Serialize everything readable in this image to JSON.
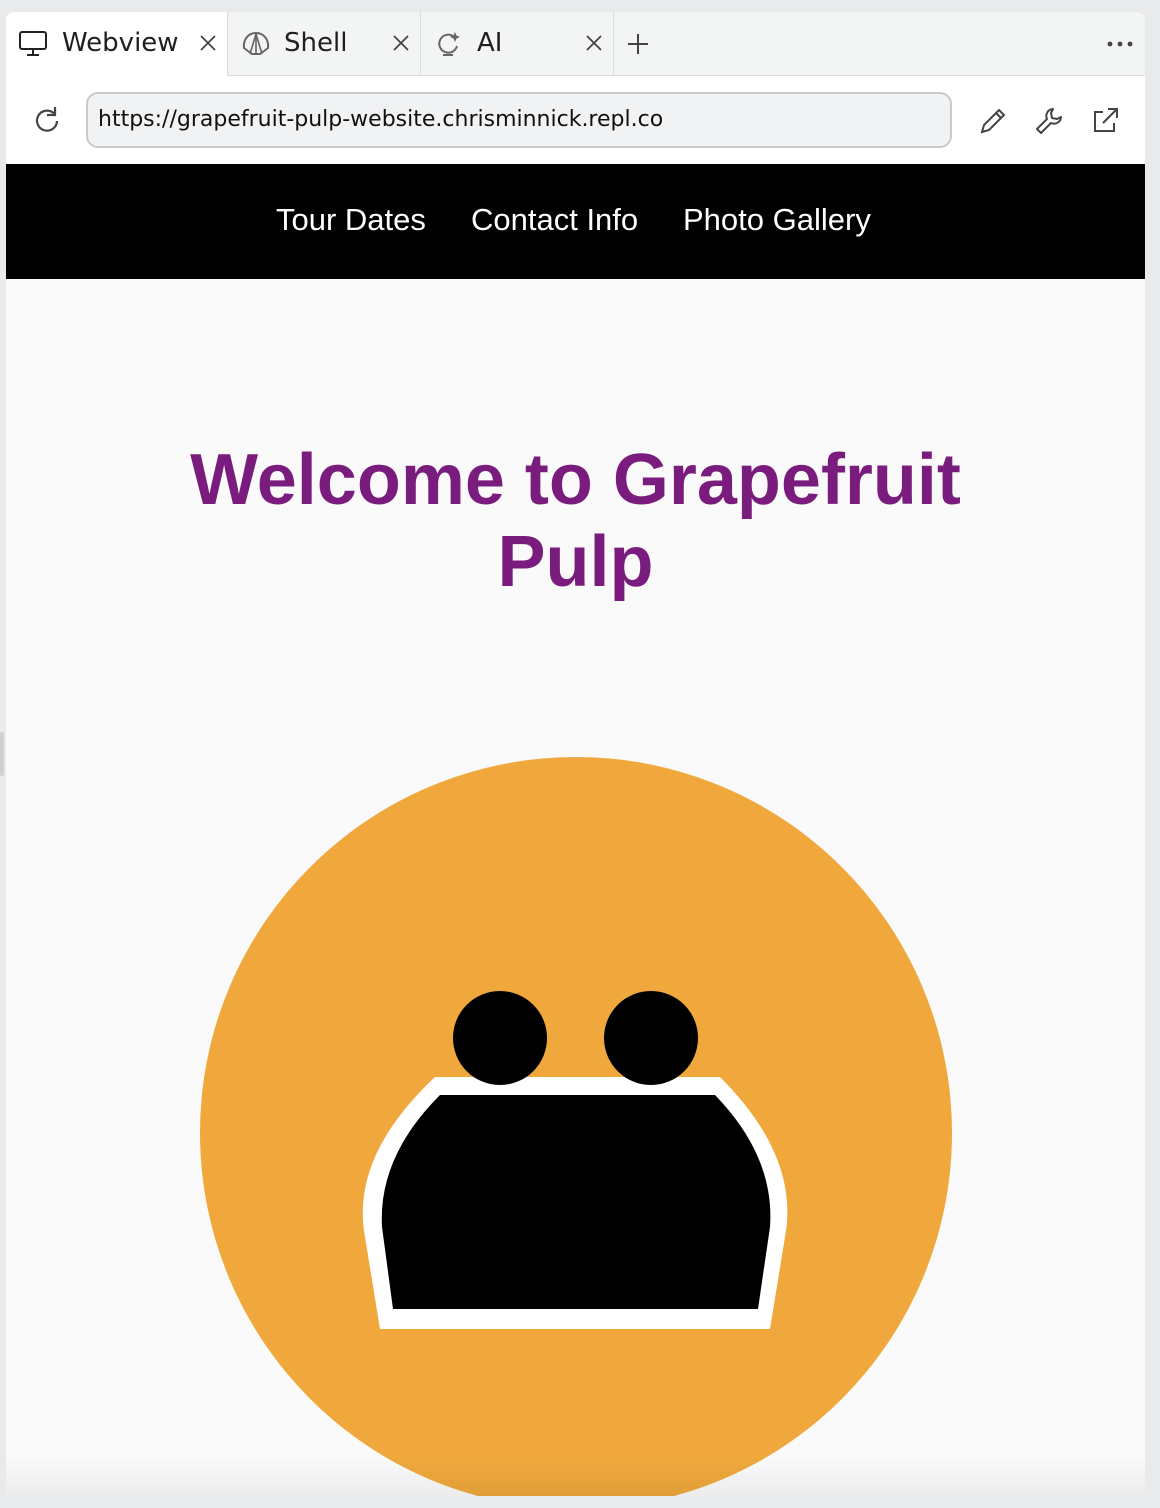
{
  "tabs": [
    {
      "label": "Webview",
      "icon": "monitor-icon",
      "active": true
    },
    {
      "label": "Shell",
      "icon": "shell-icon",
      "active": false
    },
    {
      "label": "AI",
      "icon": "ai-sparkle-icon",
      "active": false
    }
  ],
  "tabbar": {
    "new_tab_icon": "plus-icon",
    "more_icon": "more-horizontal-icon"
  },
  "address": {
    "url": "https://grapefruit-pulp-website.chrisminnick.repl.co",
    "reload_icon": "reload-icon",
    "tools": [
      "pencil-icon",
      "wrench-icon",
      "external-link-icon"
    ]
  },
  "site": {
    "nav": [
      "Tour Dates",
      "Contact Info",
      "Photo Gallery"
    ],
    "title_line1": "Welcome to Grapefruit",
    "title_line2": "Pulp",
    "colors": {
      "nav_bg": "#000000",
      "nav_text": "#ffffff",
      "title": "#7a1c7d",
      "logo_circle": "#f0a83c",
      "logo_outline": "#ffffff",
      "logo_figure": "#000000"
    }
  }
}
